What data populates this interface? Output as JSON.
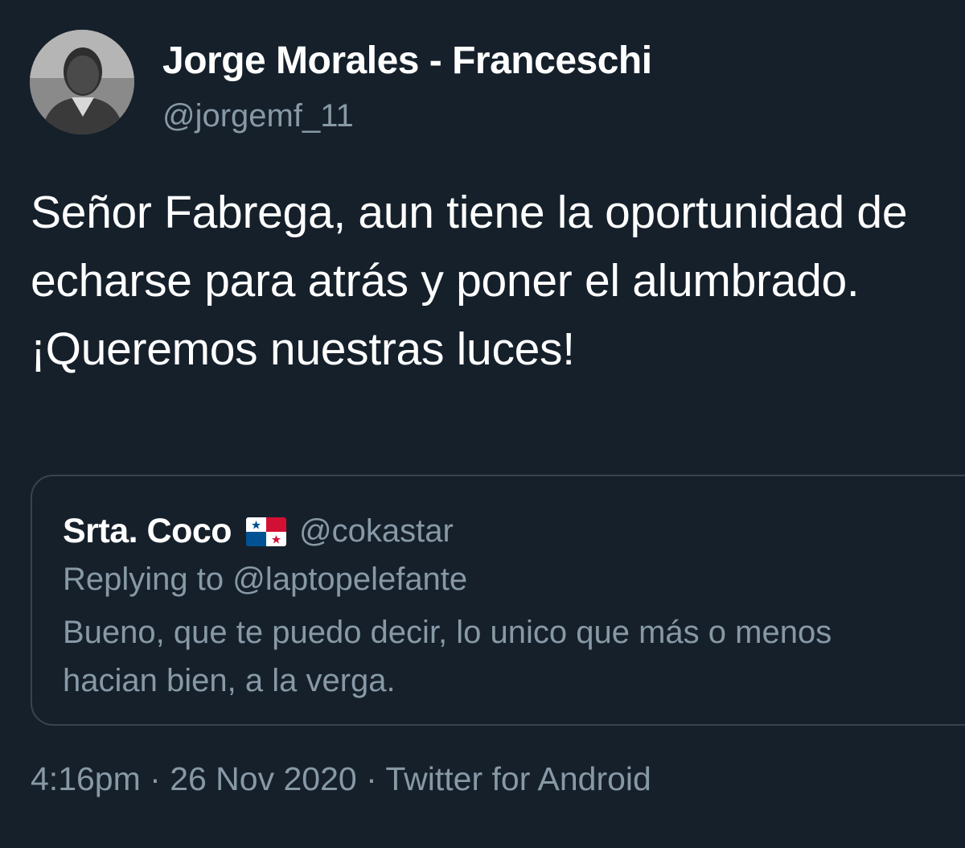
{
  "tweet": {
    "author": {
      "display_name": "Jorge Morales - Franceschi",
      "handle": "@jorgemf_11",
      "avatar_icon": "profile-photo"
    },
    "text": "Señor Fabrega, aun tiene la oportunidad de echarse para atrás y poner el alumbrado. ¡Queremos nuestras luces!",
    "quoted_tweet": {
      "display_name": "Srta. Coco",
      "flag_icon": "panama-flag-icon",
      "handle": "@cokastar",
      "replying_to": "Replying to @laptopelefante",
      "text": "Bueno, que te puedo decir, lo unico que más o menos hacian bien, a la verga."
    },
    "meta": "4:16pm · 26 Nov 2020 · Twitter for Android"
  },
  "colors": {
    "background": "#15202b",
    "primary_text": "#ffffff",
    "secondary_text": "#8899a6",
    "border": "#38444d"
  }
}
